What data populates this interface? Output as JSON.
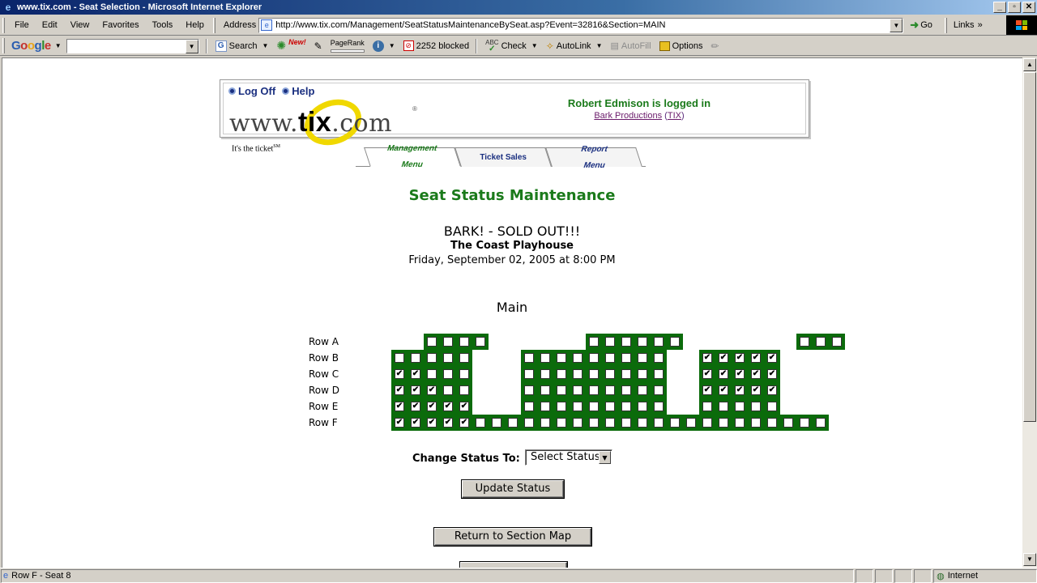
{
  "window": {
    "title": "www.tix.com - Seat Selection - Microsoft Internet Explorer",
    "buttons": [
      "_",
      "▫",
      "✕"
    ]
  },
  "menubar": {
    "items": [
      "File",
      "Edit",
      "View",
      "Favorites",
      "Tools",
      "Help"
    ],
    "address_label": "Address",
    "url": "http://www.tix.com/Management/SeatStatusMaintenanceBySeat.asp?Event=32816&Section=MAIN",
    "go_label": "Go",
    "links_label": "Links"
  },
  "google_toolbar": {
    "logo": [
      "G",
      "o",
      "o",
      "g",
      "l",
      "e"
    ],
    "search_label": "Search",
    "new_badge": "New!",
    "pagerank_label": "PageRank",
    "blocked_label": "2252 blocked",
    "check_label": "Check",
    "autolink_label": "AutoLink",
    "autofill_label": "AutoFill",
    "options_label": "Options"
  },
  "header": {
    "logoff": "Log Off",
    "help": "Help",
    "logo_prefix": "www.",
    "logo_main": "tix",
    "logo_suffix": ".com",
    "logo_reg": "®",
    "tagline": "It's the ticket",
    "tagline_sm": "SM",
    "logged_in": "Robert Edmison is logged in",
    "org_link": "Bark Productions",
    "org_code": "TIX"
  },
  "tabs": [
    {
      "line1": "Management",
      "line2": "Menu"
    },
    {
      "line1": "Ticket Sales",
      "line2": ""
    },
    {
      "line1": "Report",
      "line2": "Menu"
    }
  ],
  "page": {
    "title": "Seat Status Maintenance",
    "event": "BARK! - SOLD OUT!!!",
    "venue": "The Coast Playhouse",
    "date": "Friday, September 02, 2005 at 8:00 PM",
    "section": "Main"
  },
  "seating": {
    "rows": [
      {
        "label": "Row A",
        "seats": "....oooo......oooooo.......ooo"
      },
      {
        "label": "Row B",
        "seats": "..ooooo...ooooooooo..xxxxx"
      },
      {
        "label": "Row C",
        "seats": "..xxooo...ooooooooo..xxxxx"
      },
      {
        "label": "Row D",
        "seats": "..xxxoo...ooooooooo..xxxxx"
      },
      {
        "label": "Row E",
        "seats": "..xxxxx...ooooooooo..ooooo"
      },
      {
        "label": "Row F",
        "seats": "..xxxxxoooooooooooooooooooooo"
      }
    ]
  },
  "form": {
    "change_label": "Change Status To:",
    "select_value": "Select Status",
    "update_button": "Update Status",
    "return_button": "Return to Section Map"
  },
  "statusbar": {
    "text": "Row F - Seat 8",
    "zone": "Internet"
  }
}
